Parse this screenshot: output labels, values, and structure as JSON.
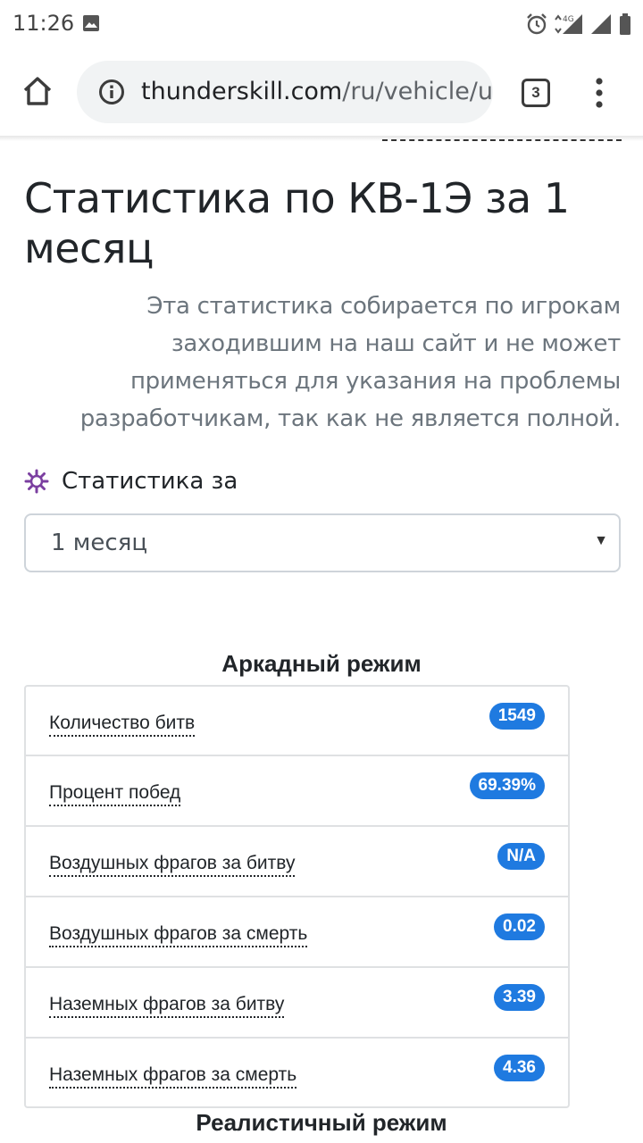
{
  "status_bar": {
    "time": "11:26",
    "network": "4G"
  },
  "browser": {
    "url_domain": "thunderskill.com",
    "url_path": "/ru/vehicle/us",
    "tab_count": "3"
  },
  "page": {
    "title": "Статистика по КВ-1Э за 1 месяц",
    "disclaimer": "Эта статистика собирается по игрокам заходившим на наш сайт и не может применяться для указания на проблемы разработчикам, так как не является полной.",
    "period_label": "Статистика за",
    "period_select_value": "1 месяц"
  },
  "arcade": {
    "title": "Аркадный режим",
    "stats": [
      {
        "label": "Количество битв",
        "value": "1549"
      },
      {
        "label": "Процент побед",
        "value": "69.39%"
      },
      {
        "label": "Воздушных фрагов за битву",
        "value": "N/A"
      },
      {
        "label": "Воздушных фрагов за смерть",
        "value": "0.02"
      },
      {
        "label": "Наземных фрагов за битву",
        "value": "3.39"
      },
      {
        "label": "Наземных фрагов за смерть",
        "value": "4.36"
      }
    ]
  },
  "realistic": {
    "title": "Реалистичный режим"
  },
  "colors": {
    "badge": "#1f7ae0",
    "period_icon": "#7b3fa0"
  }
}
